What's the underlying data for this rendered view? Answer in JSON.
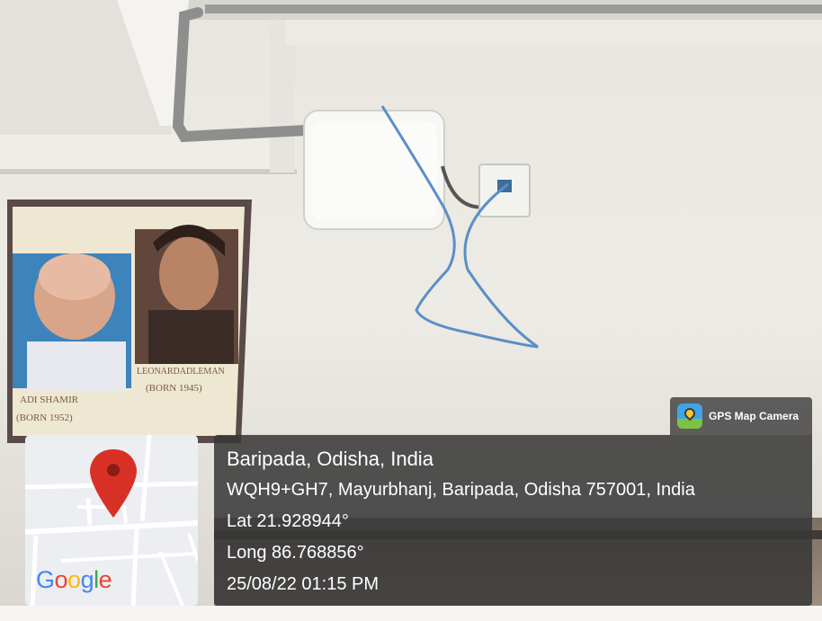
{
  "badge": {
    "app_name": "GPS Map Camera",
    "icon": "gps-map-camera-icon"
  },
  "location": {
    "title": "Baripada, Odisha, India",
    "address": "WQH9+GH7, Mayurbhanj, Baripada, Odisha 757001, India",
    "latitude": "Lat 21.928944°",
    "longitude": "Long 86.768856°",
    "datetime": "25/08/22 01:15 PM"
  },
  "map": {
    "provider_logo": [
      "G",
      "o",
      "o",
      "g",
      "l",
      "e"
    ],
    "marker_color": "#d93025"
  },
  "poster": {
    "left_caption_name": "ADI SHAMIR",
    "left_caption_born": "(BORN 1952)",
    "right_caption_name": "LEONARDADLEMAN",
    "right_caption_born": "(BORN 1945)"
  }
}
